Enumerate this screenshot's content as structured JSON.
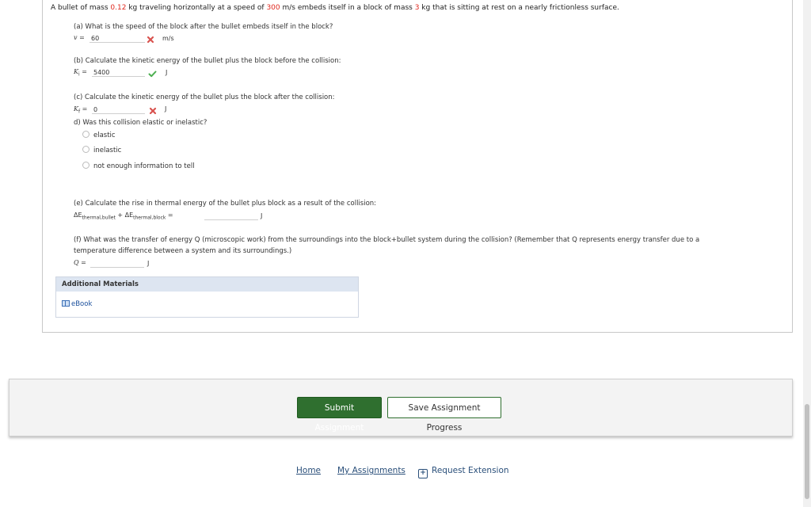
{
  "question": {
    "stem": {
      "pre1": "A bullet of mass ",
      "bullet_mass": "0.12",
      "pre2": " kg traveling horizontally at a speed of ",
      "speed": "300",
      "pre3": " m/s embeds itself in a block of mass ",
      "block_mass": "3",
      "pre4": " kg that is sitting at rest on a nearly frictionless surface."
    },
    "part_a": {
      "prompt": "(a) What is the speed of the block after the bullet embeds itself in the block?",
      "var": "v",
      "eq": " = ",
      "value": "60",
      "unit": "m/s",
      "status": "incorrect"
    },
    "part_b": {
      "prompt": "(b) Calculate the kinetic energy of the bullet plus the block before the collision:",
      "var": "K",
      "sub": "i",
      "eq": " = ",
      "value": "5400",
      "unit": "J",
      "status": "correct"
    },
    "part_c": {
      "prompt": "(c) Calculate the kinetic energy of the bullet plus the block after the collision:",
      "var": "K",
      "sub": "f",
      "eq": " = ",
      "value": "0",
      "unit": "J",
      "status": "incorrect"
    },
    "part_d": {
      "prompt": "d) Was this collision elastic or inelastic?",
      "options": [
        "elastic",
        "inelastic",
        "not enough information to tell"
      ]
    },
    "part_e": {
      "prompt": "(e) Calculate the rise in thermal energy of the bullet plus block as a result of the collision:",
      "term1": "ΔE",
      "term1_sub": "thermal,bullet",
      "plus": " + ",
      "term2": "ΔE",
      "term2_sub": "thermal,block",
      "eq": " = ",
      "value": "",
      "unit": "J"
    },
    "part_f": {
      "prompt_line1": "(f) What was the transfer of energy Q (microscopic work) from the surroundings into the block+bullet system during the collision? (Remember that Q represents energy transfer due to a",
      "prompt_line2": "temperature difference between a system and its surroundings.)",
      "var": "Q",
      "eq": " = ",
      "value": "",
      "unit": "J"
    }
  },
  "additional_materials": {
    "title": "Additional Materials",
    "ebook_label": "eBook"
  },
  "footer": {
    "submit_label": "Submit Assignment",
    "save_label": "Save Assignment Progress"
  },
  "bottom_nav": {
    "home": "Home",
    "my_assignments": "My Assignments",
    "request_extension": "Request Extension"
  },
  "colors": {
    "highlight_red": "#e0281e",
    "correct_green": "#4caf50",
    "incorrect_red": "#d9534f",
    "button_green": "#2f6f2f"
  },
  "icons": {
    "incorrect": "x-icon",
    "correct": "check-icon",
    "ebook": "book-icon",
    "extension": "calendar-plus-icon"
  }
}
